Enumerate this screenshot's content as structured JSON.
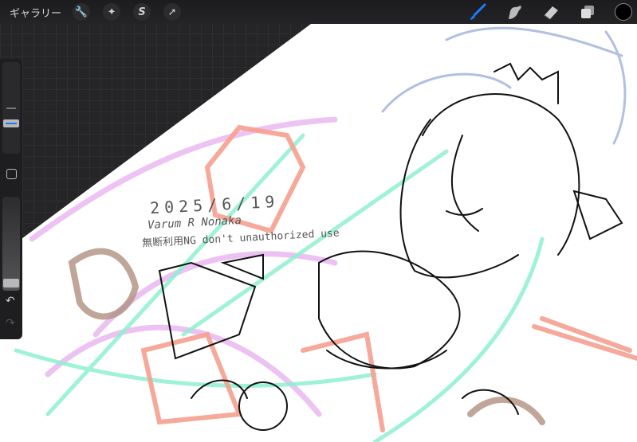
{
  "topbar": {
    "gallery_label": "ギャラリー",
    "left_tools": [
      {
        "name": "actions",
        "icon": "wrench-icon",
        "glyph": "🔧"
      },
      {
        "name": "adjustments",
        "icon": "magic-wand-icon",
        "glyph": "✦"
      },
      {
        "name": "selection",
        "icon": "selection-icon",
        "glyph": "S"
      },
      {
        "name": "transform",
        "icon": "arrow-icon",
        "glyph": "➚"
      }
    ],
    "right_tools": [
      "brush-icon",
      "smudge-icon",
      "eraser-icon",
      "layers-icon"
    ],
    "active_tool": "brush",
    "accent_color": "#1a7cff",
    "current_color": "#000000"
  },
  "sidebar": {
    "brush_size": 0.6,
    "opacity": 0.05,
    "undo_icon": "↶",
    "redo_icon": "↷"
  },
  "artwork": {
    "date": "2025/6/19",
    "signature": "Varum R Nonaka",
    "notice": "無断利用NG don't unauthorized use"
  }
}
